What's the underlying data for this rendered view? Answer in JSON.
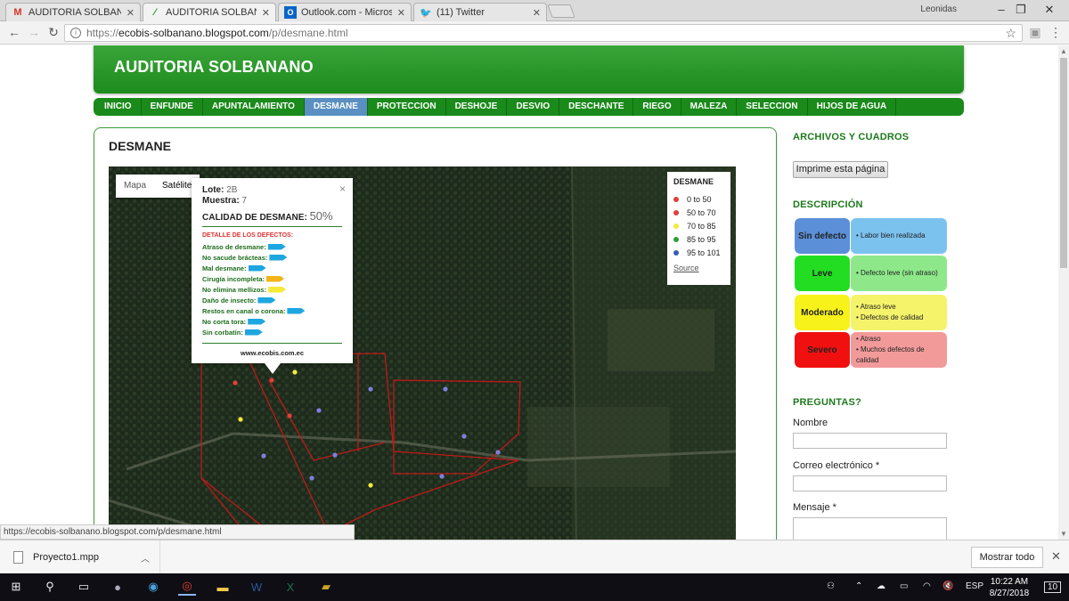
{
  "browser": {
    "tabs": [
      {
        "label": "AUDITORIA SOLBANANO",
        "icon": "gmail-icon",
        "active": false
      },
      {
        "label": "AUDITORIA SOLBANANO",
        "icon": "blogger-leaf-icon",
        "active": true
      },
      {
        "label": "Outlook.com - Microsoft",
        "icon": "outlook-icon",
        "active": false
      },
      {
        "label": "(11) Twitter",
        "icon": "twitter-icon",
        "active": false
      }
    ],
    "user": "Leonidas",
    "url_prefix": "https://",
    "url_host": "ecobis-solbanano.blogspot.com",
    "url_path": "/p/desmane.html"
  },
  "site": {
    "title": "AUDITORIA SOLBANANO",
    "nav": [
      "INICIO",
      "ENFUNDE",
      "APUNTALAMIENTO",
      "DESMANE",
      "PROTECCION",
      "DESHOJE",
      "DESVIO",
      "DESCHANTE",
      "RIEGO",
      "MALEZA",
      "SELECCION",
      "HIJOS DE AGUA"
    ],
    "nav_active": "DESMANE",
    "accent": "#1a8a1a"
  },
  "post": {
    "title": "DESMANE",
    "map": {
      "type_buttons": [
        "Mapa",
        "Satélite"
      ],
      "legend": {
        "title": "DESMANE",
        "items": [
          {
            "label": "0 to 50",
            "color": "#e0413b"
          },
          {
            "label": "50 to 70",
            "color": "#e0413b"
          },
          {
            "label": "70 to 85",
            "color": "#f5e93a"
          },
          {
            "label": "85 to 95",
            "color": "#2e9e3a"
          },
          {
            "label": "95 to 101",
            "color": "#3a5fb0"
          }
        ],
        "source": "Source"
      },
      "info": {
        "lote_label": "Lote:",
        "lote_value": "2B",
        "muestra_label": "Muestra:",
        "muestra_value": "7",
        "calidad_label": "CALIDAD DE DESMANE:",
        "calidad_value": "50%",
        "detalle_title": "DETALLE DE LOS DEFECTOS:",
        "defects": [
          {
            "label": "Atraso de desmane:",
            "color": "#1ea6e0"
          },
          {
            "label": "No sacude brácteas:",
            "color": "#1ea6e0"
          },
          {
            "label": "Mal desmane:",
            "color": "#1ea6e0"
          },
          {
            "label": "Cirugía incompleta:",
            "color": "#f2b418"
          },
          {
            "label": "No elimina mellizos:",
            "color": "#f5e93a"
          },
          {
            "label": "Daño de insecto:",
            "color": "#1ea6e0"
          },
          {
            "label": "Restos en canal o corona:",
            "color": "#1ea6e0"
          },
          {
            "label": "No corta tora:",
            "color": "#1ea6e0"
          },
          {
            "label": "Sin corbatín:",
            "color": "#1ea6e0"
          }
        ],
        "footer": "www.ecobis.com.ec",
        "close": "×"
      }
    }
  },
  "sidebar": {
    "archivos_title": "ARCHIVOS Y CUADROS",
    "print_button": "Imprime esta página",
    "descripcion_title": "DESCRIPCIÓN",
    "descripcion": [
      {
        "key": "Sin defecto",
        "key_color": "#5b8fd8",
        "box_color": "#7cc2ee",
        "lines": [
          "• Labor bien realizada"
        ]
      },
      {
        "key": "Leve",
        "key_color": "#22dd22",
        "box_color": "#8ee88a",
        "lines": [
          "• Defecto leve (sin atraso)"
        ]
      },
      {
        "key": "Moderado",
        "key_color": "#f7f21a",
        "box_color": "#f5f36a",
        "lines": [
          "• Atraso leve",
          "• Defectos de calidad"
        ]
      },
      {
        "key": "Severo",
        "key_color": "#f01010",
        "box_color": "#f29a9a",
        "lines": [
          "• Atraso",
          "• Muchos defectos de calidad"
        ]
      }
    ],
    "preguntas_title": "PREGUNTAS?",
    "form": {
      "nombre_label": "Nombre",
      "correo_label": "Correo electrónico *",
      "mensaje_label": "Mensaje *"
    }
  },
  "status_url": "https://ecobis-solbanano.blogspot.com/p/desmane.html",
  "downloads": {
    "file": "Proyecto1.mpp",
    "show_all": "Mostrar todo"
  },
  "taskbar": {
    "lang": "ESP",
    "time": "10:22 AM",
    "date": "8/27/2018",
    "notifications": "10"
  }
}
